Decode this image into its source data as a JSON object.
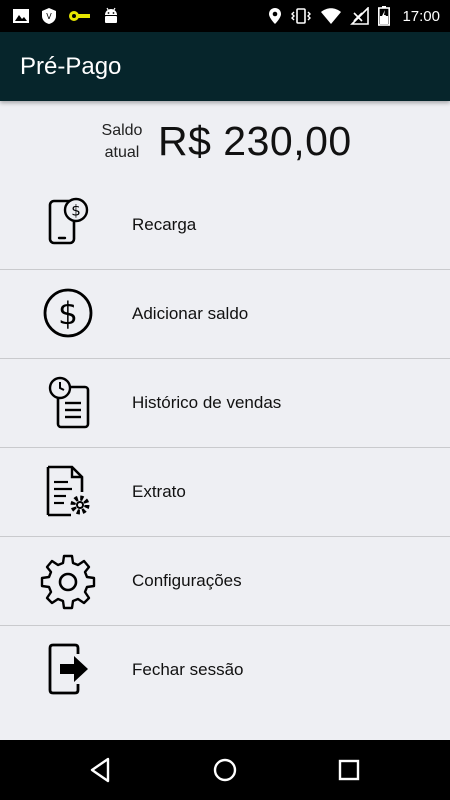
{
  "status_bar": {
    "time": "17:00",
    "icons_left": [
      "image-icon",
      "shield-icon",
      "key-icon",
      "android-icon"
    ],
    "icons_right": [
      "location-icon",
      "vibrate-icon",
      "wifi-icon",
      "no-signal-icon",
      "battery-icon"
    ]
  },
  "app_bar": {
    "title": "Pré-Pago",
    "color": "#06252b"
  },
  "balance": {
    "label": "Saldo atual",
    "value": "R$ 230,00"
  },
  "menu": {
    "items": [
      {
        "label": "Recarga",
        "icon": "phone-recharge-icon"
      },
      {
        "label": "Adicionar saldo",
        "icon": "dollar-circle-icon"
      },
      {
        "label": "Histórico de vendas",
        "icon": "history-list-icon"
      },
      {
        "label": "Extrato",
        "icon": "statement-settings-icon"
      },
      {
        "label": "Configurações",
        "icon": "gear-icon"
      },
      {
        "label": "Fechar sessão",
        "icon": "logout-icon"
      }
    ]
  },
  "nav_bar": {
    "buttons": [
      "back-icon",
      "home-icon",
      "recents-icon"
    ]
  }
}
